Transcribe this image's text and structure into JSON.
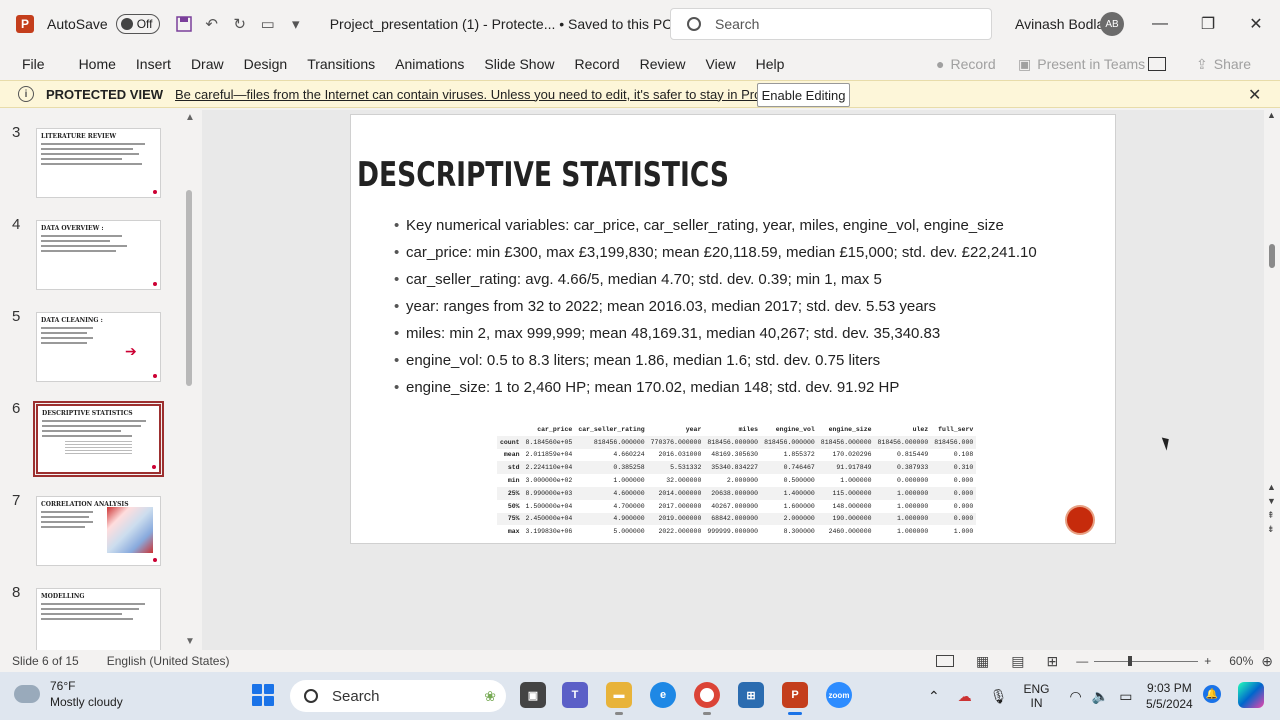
{
  "titlebar": {
    "autosave_label": "AutoSave",
    "autosave_state": "Off",
    "doc_title": "Project_presentation (1)  -  Protecte...  •  Saved to this PC",
    "search_placeholder": "Search",
    "user_name": "Avinash Bodla",
    "user_initials": "AB"
  },
  "menu": {
    "items": [
      "File",
      "Home",
      "Insert",
      "Draw",
      "Design",
      "Transitions",
      "Animations",
      "Slide Show",
      "Record",
      "Review",
      "View",
      "Help"
    ],
    "record_label": "Record",
    "teams_label": "Present in Teams",
    "share_label": "Share"
  },
  "protected_view": {
    "title": "PROTECTED VIEW",
    "message": "Be careful—files from the Internet can contain viruses. Unless you need to edit, it's safer to stay in Protected View.",
    "enable_label": "Enable Editing"
  },
  "thumbnails": [
    {
      "num": "3",
      "title": "LITERATURE REVIEW"
    },
    {
      "num": "4",
      "title": "DATA OVERVIEW :"
    },
    {
      "num": "5",
      "title": "DATA CLEANING :"
    },
    {
      "num": "6",
      "title": "DESCRIPTIVE STATISTICS"
    },
    {
      "num": "7",
      "title": "CORRELATION ANALYSIS"
    },
    {
      "num": "8",
      "title": "MODELLING"
    }
  ],
  "slide": {
    "title": "DESCRIPTIVE STATISTICS",
    "bullets": [
      "Key numerical variables: car_price, car_seller_rating, year, miles, engine_vol, engine_size",
      "car_price: min £300, max £3,199,830; mean £20,118.59, median £15,000; std. dev. £22,241.10",
      "car_seller_rating: avg. 4.66/5, median 4.70; std. dev. 0.39; min 1, max 5",
      "year: ranges from 32 to 2022; mean 2016.03, median 2017; std. dev. 5.53 years",
      "miles: min 2, max 999,999; mean 48,169.31, median 40,267; std. dev. 35,340.83",
      "engine_vol: 0.5 to 8.3 liters; mean 1.86, median 1.6; std. dev. 0.75 liters",
      "engine_size: 1 to 2,460 HP; mean 170.02, median 148; std. dev. 91.92 HP"
    ],
    "table": {
      "headers": [
        "",
        "car_price",
        "car_seller_rating",
        "year",
        "miles",
        "engine_vol",
        "engine_size",
        "ulez",
        "full_serv"
      ],
      "rows": [
        [
          "count",
          "8.184560e+05",
          "818456.000000",
          "770376.000000",
          "818456.000000",
          "818456.000000",
          "818456.000000",
          "818456.000000",
          "818456.000"
        ],
        [
          "mean",
          "2.011859e+04",
          "4.660224",
          "2016.031000",
          "48169.305630",
          "1.855372",
          "170.020296",
          "0.815449",
          "0.108"
        ],
        [
          "std",
          "2.224110e+04",
          "0.385258",
          "5.531332",
          "35340.834227",
          "0.746467",
          "91.917849",
          "0.387933",
          "0.310"
        ],
        [
          "min",
          "3.000000e+02",
          "1.000000",
          "32.000000",
          "2.000000",
          "0.500000",
          "1.000000",
          "0.000000",
          "0.000"
        ],
        [
          "25%",
          "8.990000e+03",
          "4.600000",
          "2014.000000",
          "20638.000000",
          "1.400000",
          "115.000000",
          "1.000000",
          "0.000"
        ],
        [
          "50%",
          "1.500000e+04",
          "4.700000",
          "2017.000000",
          "40267.000000",
          "1.600000",
          "148.000000",
          "1.000000",
          "0.000"
        ],
        [
          "75%",
          "2.450000e+04",
          "4.900000",
          "2019.000000",
          "68842.000000",
          "2.000000",
          "190.000000",
          "1.000000",
          "0.000"
        ],
        [
          "max",
          "3.199830e+06",
          "5.000000",
          "2022.000000",
          "999999.000000",
          "8.300000",
          "2460.000000",
          "1.000000",
          "1.000"
        ]
      ]
    }
  },
  "statusbar": {
    "slide_info": "Slide 6 of 15",
    "language": "English (United States)",
    "zoom": "60%"
  },
  "taskbar": {
    "temp": "76°F",
    "weather": "Mostly cloudy",
    "search_label": "Search",
    "lang_top": "ENG",
    "lang_bottom": "IN",
    "time": "9:03 PM",
    "date": "5/5/2024"
  }
}
